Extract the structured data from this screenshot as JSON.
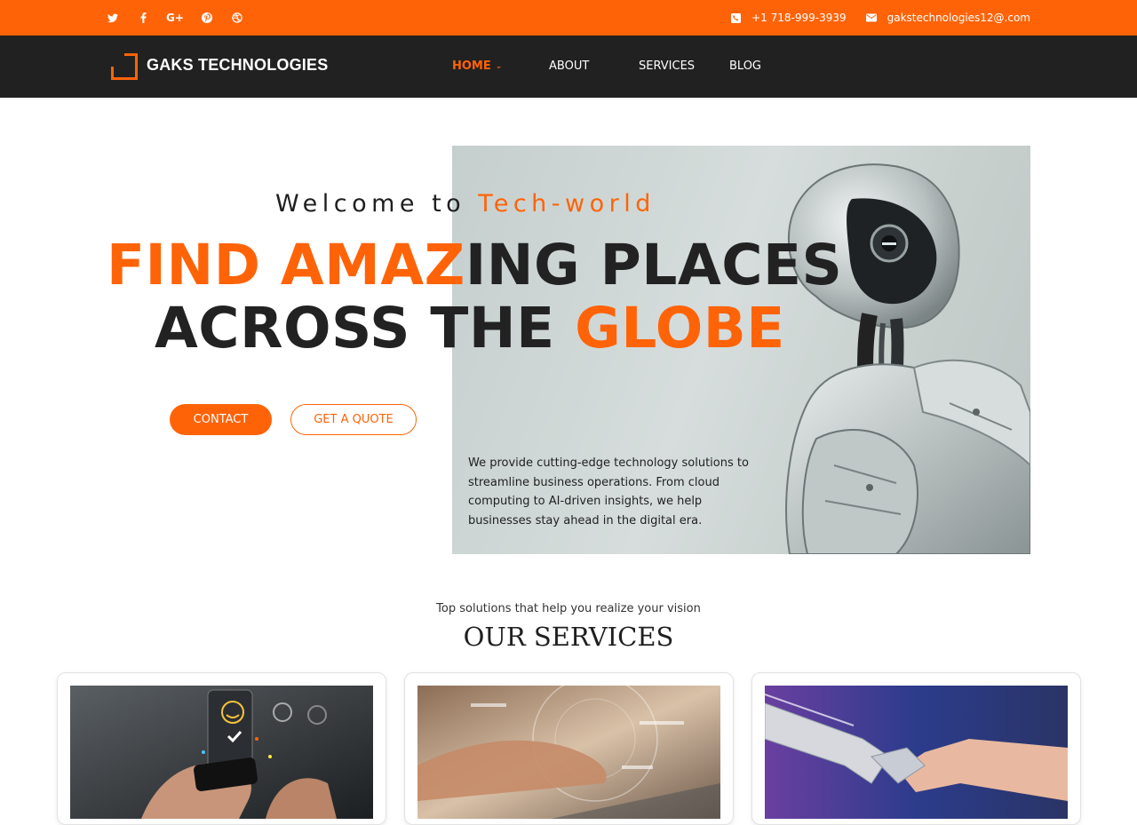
{
  "topbar": {
    "social": [
      {
        "icon": "twitter-icon",
        "glyph": "t"
      },
      {
        "icon": "facebook-icon",
        "glyph": "f"
      },
      {
        "icon": "google-plus-icon",
        "glyph": "G+"
      },
      {
        "icon": "pinterest-icon",
        "glyph": "P"
      },
      {
        "icon": "dribbble-icon",
        "glyph": "◎"
      }
    ],
    "phone": "+1 718-999-3939",
    "email": "gakstechnologies12@.com"
  },
  "nav": {
    "logo_text": "GAKS TECHNOLOGIES",
    "items": [
      {
        "label": "HOME",
        "active": true
      },
      {
        "label": "ABOUT",
        "active": false
      },
      {
        "label": "SERVICES",
        "active": false
      },
      {
        "label": "BLOG",
        "active": false
      }
    ]
  },
  "hero": {
    "welcome_prefix": "Welcome to",
    "welcome_accent": "Tech-world",
    "line1_orange": "FIND AMAZ",
    "line1_dark": "ING PLACES",
    "line2_dark": "ACROSS THE",
    "line2_orange": "GLOBE",
    "contact_label": "CONTACT",
    "quote_label": "GET A QUOTE",
    "description": "We provide cutting-edge technology solutions to streamline business operations. From cloud computing to AI-driven insights, we help businesses stay ahead in the digital era."
  },
  "services": {
    "subtitle": "Top solutions that help you realize your vision",
    "title": "OUR SERVICES",
    "cards": [
      {
        "image": "customer-feedback-photo"
      },
      {
        "image": "typing-laptop-photo"
      },
      {
        "image": "robot-human-handshake-photo"
      }
    ]
  },
  "colors": {
    "accent": "#ff6308",
    "navbar": "#212121",
    "text": "#222222"
  }
}
